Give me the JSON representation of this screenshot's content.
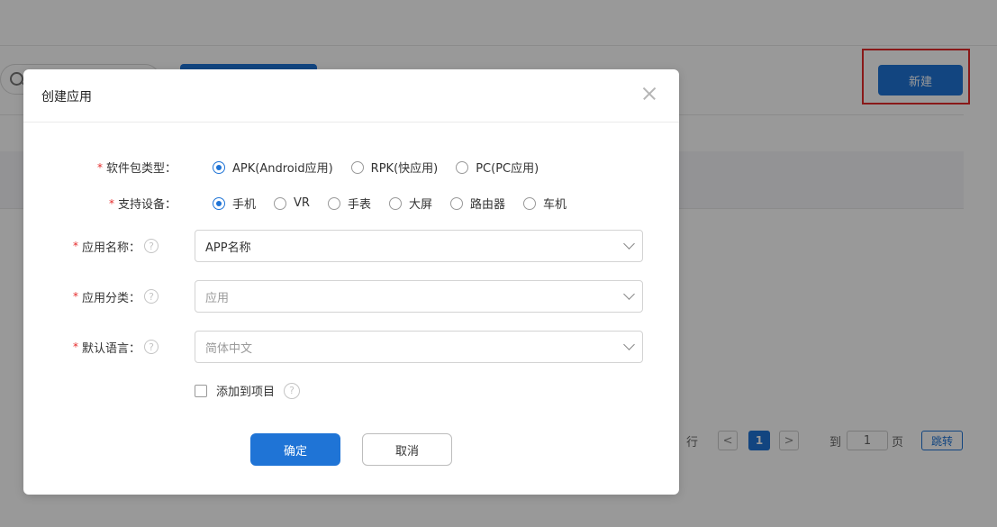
{
  "background": {
    "new_button_label": "新建",
    "pagination": {
      "rows_suffix": "行",
      "prev": "<",
      "current_page": "1",
      "next": ">",
      "goto_label": "到",
      "goto_value": "1",
      "page_unit": "页",
      "jump_label": "跳转"
    },
    "highlight_color": "#e52b2b"
  },
  "dialog": {
    "title": "创建应用",
    "package_type": {
      "label": "软件包类型：",
      "options": [
        "APK(Android应用)",
        "RPK(快应用)",
        "PC(PC应用)"
      ],
      "selected": "APK(Android应用)"
    },
    "devices": {
      "label": "支持设备：",
      "options": [
        "手机",
        "VR",
        "手表",
        "大屏",
        "路由器",
        "车机"
      ],
      "selected": "手机"
    },
    "app_name": {
      "label": "应用名称：",
      "value": "APP名称",
      "help_icon": "?"
    },
    "app_category": {
      "label": "应用分类：",
      "placeholder": "应用",
      "help_icon": "?"
    },
    "default_language": {
      "label": "默认语言：",
      "placeholder": "简体中文",
      "help_icon": "?"
    },
    "add_to_project": {
      "label": "添加到项目",
      "checked": false,
      "help_icon": "?"
    },
    "confirm_label": "确定",
    "cancel_label": "取消"
  },
  "colors": {
    "primary": "#1f74d6",
    "required_star": "#e52b2b"
  }
}
